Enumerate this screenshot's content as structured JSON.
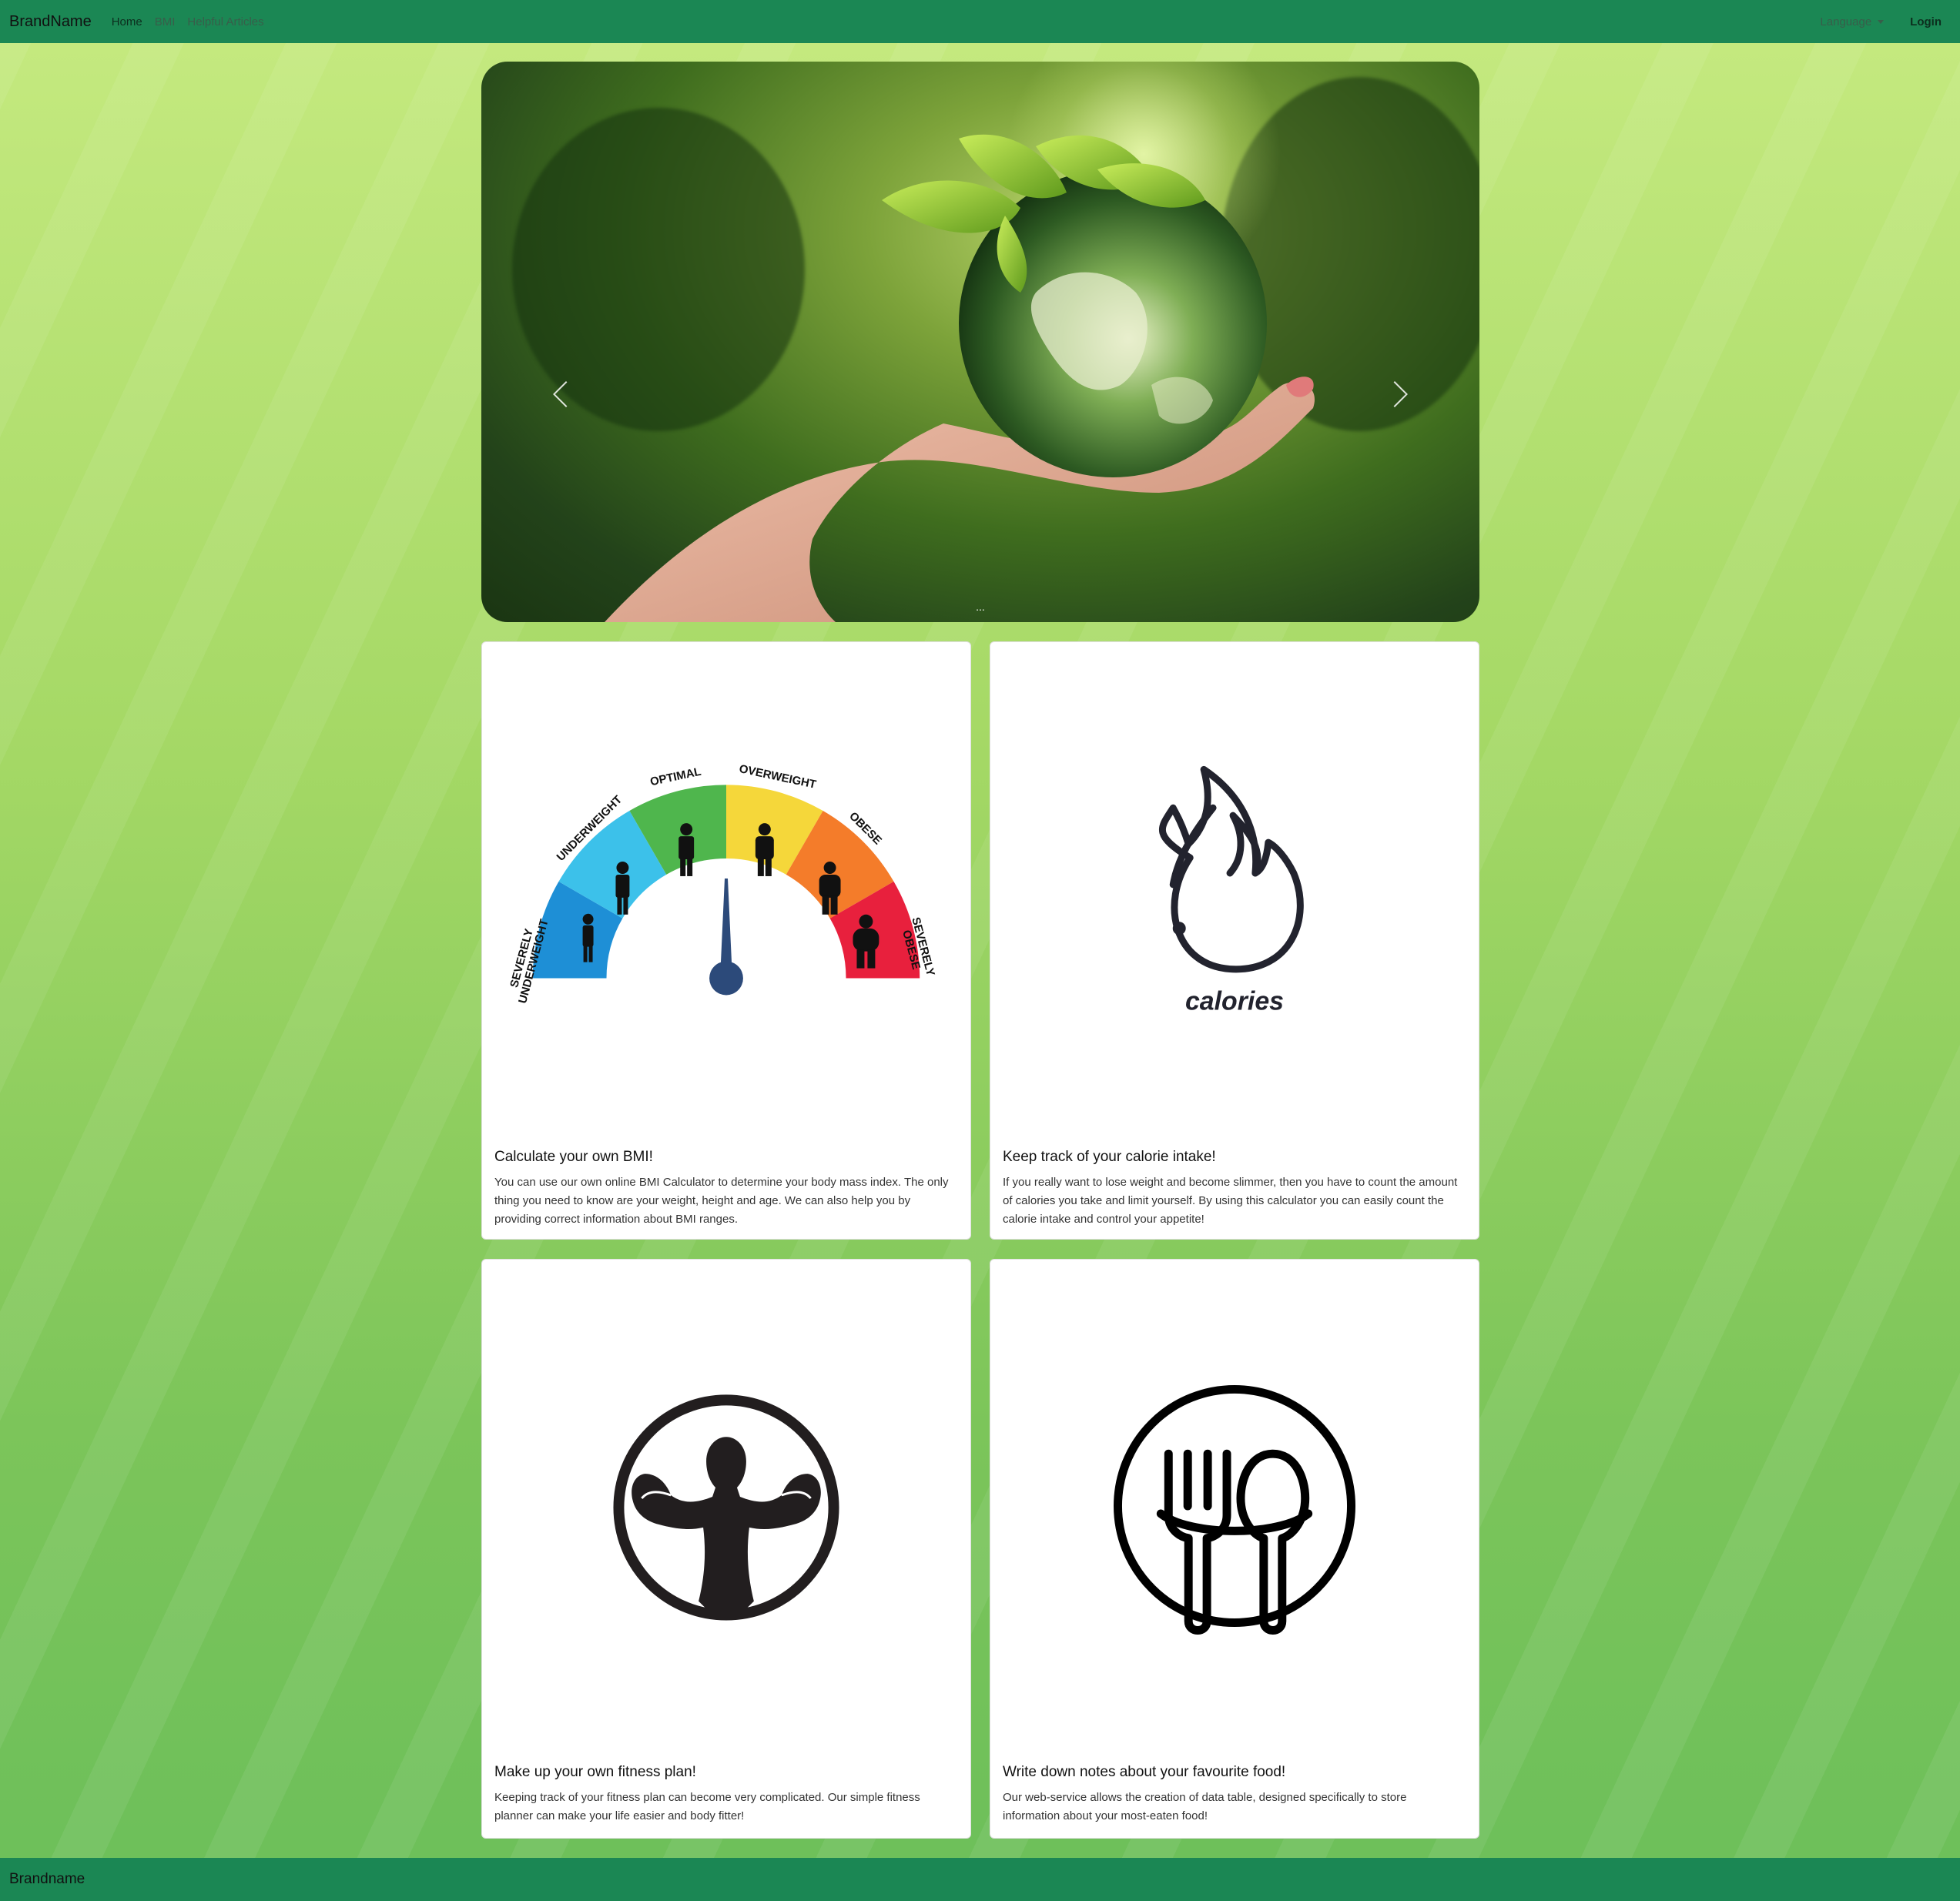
{
  "navbar": {
    "brand": "BrandName",
    "links": [
      {
        "label": "Home"
      },
      {
        "label": "BMI"
      },
      {
        "label": "Helpful Articles"
      }
    ],
    "language_label": "Language",
    "login_label": "Login"
  },
  "carousel": {
    "caption_title": "...",
    "caption_text": "...",
    "slide_count": 3,
    "active_slide": 1
  },
  "cards": [
    {
      "title": "Calculate your own BMI!",
      "text": "You can use our own online BMI Calculator to determine your body mass index. The only thing you need to know are your weight, height and age. We can also help you by providing correct information about BMI ranges.",
      "gauge_labels": [
        "SEVERELY UNDERWEIGHT",
        "UNDERWEIGHT",
        "OPTIMAL",
        "OVERWEIGHT",
        "OBESE",
        "SEVERELY OBESE"
      ]
    },
    {
      "title": "Keep track of your calorie intake!",
      "text": "If you really want to lose weight and become slimmer, then you have to count the amount of calories you take and limit yourself. By using this calculator you can easily count the calorie intake and control your appetite!",
      "image_label": "calories"
    },
    {
      "title": "Make up your own fitness plan!",
      "text": "Keeping track of your fitness plan can become very complicated. Our simple fitness planner can make your life easier and body fitter!"
    },
    {
      "title": "Write down notes about your favourite food!",
      "text": "Our web-service allows the creation of data table, designed specifically to store information about your most-eaten food!"
    }
  ],
  "footer": {
    "brand": "Brandname"
  },
  "colors": {
    "navbar": "#1b8754",
    "gauge": [
      "#1e8fd6",
      "#3cc1ea",
      "#4fb64d",
      "#f5d73a",
      "#f47c2a",
      "#e8203d"
    ],
    "needle": "#2c4a7a"
  }
}
